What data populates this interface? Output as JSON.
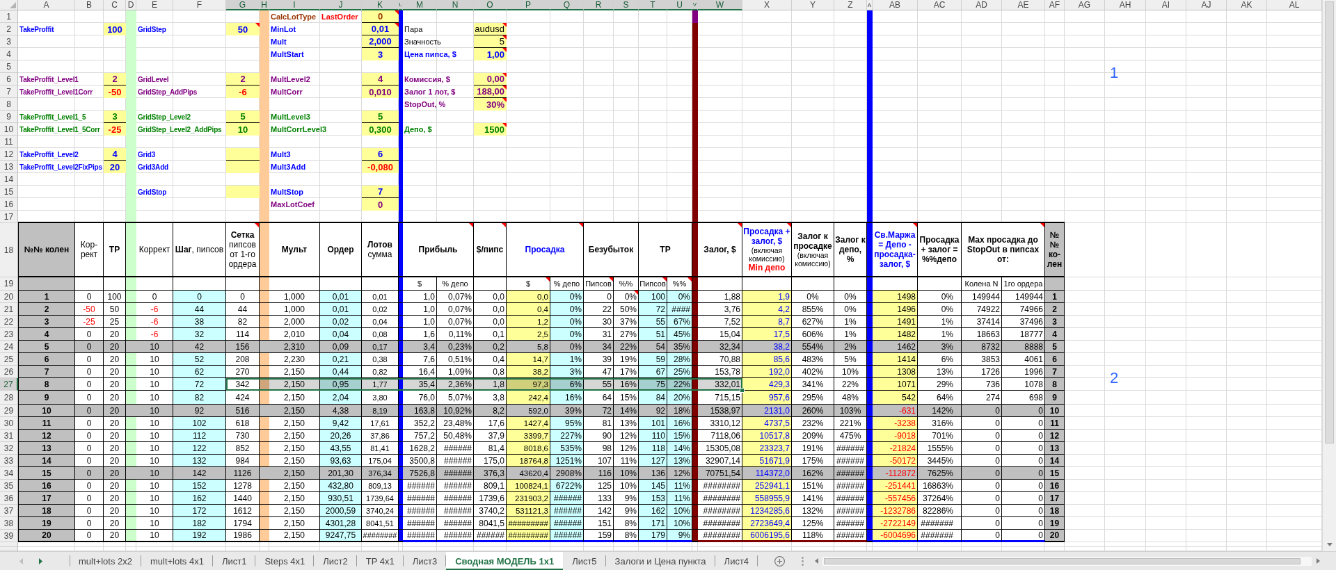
{
  "column_headers": [
    {
      "label": "A",
      "selected": false
    },
    {
      "label": "B",
      "selected": false
    },
    {
      "label": "C",
      "selected": false
    },
    {
      "label": "D",
      "selected": false
    },
    {
      "label": "E",
      "selected": false
    },
    {
      "label": "F",
      "selected": false
    },
    {
      "label": "G",
      "selected": true
    },
    {
      "label": "H",
      "selected": true
    },
    {
      "label": "I",
      "selected": true
    },
    {
      "label": "J",
      "selected": true
    },
    {
      "label": "K",
      "selected": true
    },
    {
      "label": "L",
      "selected": true
    },
    {
      "label": "M",
      "selected": true
    },
    {
      "label": "N",
      "selected": true
    },
    {
      "label": "O",
      "selected": true
    },
    {
      "label": "P",
      "selected": true
    },
    {
      "label": "Q",
      "selected": true
    },
    {
      "label": "R",
      "selected": true
    },
    {
      "label": "S",
      "selected": true
    },
    {
      "label": "T",
      "selected": true
    },
    {
      "label": "U",
      "selected": true
    },
    {
      "label": "V",
      "selected": true
    },
    {
      "label": "W",
      "selected": true
    },
    {
      "label": "X",
      "selected": false
    },
    {
      "label": "Y",
      "selected": false
    },
    {
      "label": "Z",
      "selected": false
    },
    {
      "label": "A",
      "selected": false
    },
    {
      "label": "AB",
      "selected": false
    },
    {
      "label": "AC",
      "selected": false
    },
    {
      "label": "AD",
      "selected": false
    },
    {
      "label": "AE",
      "selected": false
    },
    {
      "label": "AF",
      "selected": false
    },
    {
      "label": "AG",
      "selected": false
    },
    {
      "label": "AH",
      "selected": false
    },
    {
      "label": "AI",
      "selected": false
    },
    {
      "label": "AJ",
      "selected": false
    },
    {
      "label": "AK",
      "selected": false
    },
    {
      "label": "AL",
      "selected": false
    }
  ],
  "rows": [
    {
      "label": "1",
      "selected": false,
      "lot": {
        "label": "CalcLotType",
        "option": {
          "label": "LastOrder",
          "color": "#ff0000"
        },
        "value": "0",
        "color": "#993300",
        "negative": false,
        "bold": true,
        "comment": true
      }
    },
    {
      "label": "2",
      "selected": false,
      "take_profit": {
        "label": "TakeProffit",
        "value": "100",
        "color": "#0000ff",
        "negative": false,
        "bold": true,
        "comment": false
      },
      "grid": {
        "label": "GridStep",
        "value": "50",
        "color": "#0000ff",
        "negative": false,
        "bold": true,
        "comment": true
      },
      "lot": {
        "label": "MinLot",
        "value": "0,01",
        "color": "#0000ff",
        "negative": false,
        "bold": true,
        "comment": true
      },
      "account": {
        "label": "Пара",
        "value": "audusd",
        "color": "#000000",
        "negative": false,
        "bold": false,
        "comment": true
      }
    },
    {
      "label": "3",
      "selected": false,
      "lot": {
        "label": "Mult",
        "value": "2,000",
        "color": "#0000ff",
        "negative": false,
        "bold": true,
        "comment": false
      },
      "account": {
        "label": "Значность",
        "value": "5",
        "color": "#000000",
        "negative": false,
        "bold": false,
        "comment": true
      }
    },
    {
      "label": "4",
      "selected": false,
      "lot": {
        "label": "MultStart",
        "value": "3",
        "color": "#0000ff",
        "negative": false,
        "bold": true,
        "comment": false
      },
      "account": {
        "label": "Цена пипса, $",
        "value": "1,00",
        "color": "#0000ff",
        "negative": false,
        "bold": true,
        "comment": true
      }
    },
    {
      "label": "5",
      "selected": false,
      "note": "1"
    },
    {
      "label": "6",
      "selected": false,
      "take_profit": {
        "label": "TakeProffit_Level1",
        "value": "2",
        "color": "#800080",
        "negative": false,
        "bold": true,
        "comment": false
      },
      "grid": {
        "label": "GridLevel",
        "value": "2",
        "color": "#800080",
        "negative": false,
        "bold": true,
        "comment": false
      },
      "lot": {
        "label": "MultLevel2",
        "value": "4",
        "color": "#800080",
        "negative": false,
        "bold": true,
        "comment": false
      },
      "account": {
        "label": "Комиссия, $",
        "value": "0,00",
        "color": "#800080",
        "negative": false,
        "bold": true,
        "comment": true
      }
    },
    {
      "label": "7",
      "selected": false,
      "take_profit": {
        "label": "TakeProffit_Level1Corr",
        "value": "-50",
        "color": "#800080",
        "negative": true,
        "bold": true,
        "comment": false
      },
      "grid": {
        "label": "GridStep_AddPips",
        "value": "-6",
        "color": "#800080",
        "negative": true,
        "bold": true,
        "comment": false
      },
      "lot": {
        "label": "MultCorr",
        "value": "0,010",
        "color": "#800080",
        "negative": false,
        "bold": true,
        "comment": false
      },
      "account": {
        "label": "Залог 1 лот, $",
        "value": "188,00",
        "color": "#800080",
        "negative": false,
        "bold": true,
        "comment": true
      }
    },
    {
      "label": "8",
      "selected": false,
      "account": {
        "label": "StopOut, %",
        "value": "30%",
        "color": "#800080",
        "negative": false,
        "bold": true,
        "comment": true
      }
    },
    {
      "label": "9",
      "selected": false,
      "take_profit": {
        "label": "TakeProffit_Level1_5",
        "value": "3",
        "color": "#008000",
        "negative": false,
        "bold": true,
        "comment": false
      },
      "grid": {
        "label": "GridStep_Level2",
        "value": "5",
        "color": "#008000",
        "negative": false,
        "bold": true,
        "comment": false
      },
      "lot": {
        "label": "MultLevel3",
        "value": "5",
        "color": "#008000",
        "negative": false,
        "bold": true,
        "comment": false
      }
    },
    {
      "label": "10",
      "selected": false,
      "take_profit": {
        "label": "TakeProffit_Level1_5Corr",
        "value": "-25",
        "color": "#008000",
        "negative": true,
        "bold": true,
        "comment": false
      },
      "grid": {
        "label": "GridStep_Level2_AddPips",
        "value": "10",
        "color": "#008000",
        "negative": false,
        "bold": true,
        "comment": false
      },
      "lot": {
        "label": "MultCorrLevel3",
        "value": "0,300",
        "color": "#008000",
        "negative": false,
        "bold": true,
        "comment": false
      },
      "account": {
        "label": "Депо, $",
        "value": "1500",
        "color": "#008000",
        "negative": false,
        "bold": true,
        "comment": true
      }
    },
    {
      "label": "11",
      "selected": false
    },
    {
      "label": "12",
      "selected": false,
      "take_profit": {
        "label": "TakeProffit_Level2",
        "value": "4",
        "color": "#0000ff",
        "negative": false,
        "bold": true,
        "comment": false
      },
      "grid": {
        "label": "Grid3",
        "color": "#0000ff",
        "bold": true,
        "comment": false
      },
      "lot": {
        "label": "Mult3",
        "value": "6",
        "color": "#0000ff",
        "negative": false,
        "bold": true,
        "comment": false
      }
    },
    {
      "label": "13",
      "selected": false,
      "take_profit": {
        "label": "TakeProffit_Level2FixPips",
        "value": "20",
        "color": "#0000ff",
        "negative": false,
        "bold": true,
        "comment": false
      },
      "grid": {
        "label": "Grid3Add",
        "color": "#0000ff",
        "bold": true,
        "comment": false
      },
      "lot": {
        "label": "Mult3Add",
        "value": "-0,080",
        "color": "#0000ff",
        "negative": true,
        "bold": true,
        "comment": false
      }
    },
    {
      "label": "14",
      "selected": false
    },
    {
      "label": "15",
      "selected": false,
      "grid": {
        "label": "GridStop",
        "color": "#0000ff",
        "bold": true,
        "comment": false
      },
      "lot": {
        "label": "MultStop",
        "value": "7",
        "color": "#0000ff",
        "negative": false,
        "bold": true,
        "comment": false
      }
    },
    {
      "label": "16",
      "selected": false,
      "lot": {
        "label": "MaxLotCoef",
        "value": "0",
        "color": "#800080",
        "negative": false,
        "bold": true,
        "comment": false
      }
    },
    {
      "label": "17",
      "selected": false
    },
    {
      "label": "18",
      "selected": false
    },
    {
      "label": "19",
      "selected": false
    },
    {
      "label": "20",
      "selected": false
    },
    {
      "label": "21",
      "selected": false
    },
    {
      "label": "22",
      "selected": false
    },
    {
      "label": "23",
      "selected": false
    },
    {
      "label": "24",
      "selected": false
    },
    {
      "label": "25",
      "selected": false
    },
    {
      "label": "26",
      "selected": false,
      "note": "2"
    },
    {
      "label": "27",
      "selected": true
    },
    {
      "label": "28",
      "selected": false
    },
    {
      "label": "29",
      "selected": false
    },
    {
      "label": "30",
      "selected": false
    },
    {
      "label": "31",
      "selected": false
    },
    {
      "label": "32",
      "selected": false
    },
    {
      "label": "33",
      "selected": false
    },
    {
      "label": "34",
      "selected": false
    },
    {
      "label": "35",
      "selected": false
    },
    {
      "label": "36",
      "selected": false
    },
    {
      "label": "37",
      "selected": false
    },
    {
      "label": "38",
      "selected": false
    },
    {
      "label": "39",
      "selected": false
    }
  ],
  "table": {
    "columns": [
      {
        "title": "№№ колен",
        "bold": true,
        "comment": false
      },
      {
        "title": "Кор-рект",
        "bold": false,
        "comment": false
      },
      {
        "title": "TP",
        "bold": true,
        "comment": false
      },
      {
        "title": "Коррект",
        "bold": false,
        "comment": false
      },
      {
        "title": "**Шаг**, пипсов",
        "bold": false,
        "comment": false
      },
      {
        "title": "**Сетка** пипсов от 1-го ордера",
        "bold": false,
        "comment": true
      },
      {
        "title": "Мульт",
        "bold": true,
        "comment": false
      },
      {
        "title": "Ордер",
        "bold": true,
        "comment": false
      },
      {
        "title": "**Лотов** сумма",
        "bold": false,
        "comment": false
      },
      {
        "title": "Прибыль",
        "bold": true,
        "comment": true,
        "subheader": {
          "label": "$",
          "comment": false
        }
      },
      {
        "subheader": {
          "label": "% депо",
          "comment": false
        }
      },
      {
        "title": "$/пипс",
        "bold": true,
        "comment": true
      },
      {
        "title": "Просадка",
        "bold": true,
        "color": "#0000ff",
        "comment": true,
        "subheader": {
          "label": "$",
          "comment": true
        }
      },
      {
        "subheader": {
          "label": "% депо",
          "comment": false
        }
      },
      {
        "title": "Безубыток",
        "bold": true,
        "comment": false,
        "subheader": {
          "label": "Пипсов",
          "comment": true
        }
      },
      {
        "subheader": {
          "label": "%%",
          "comment": false
        }
      },
      {
        "title": "TP",
        "bold": true,
        "comment": false,
        "subheader": {
          "label": "Пипсов",
          "comment": true
        }
      },
      {
        "subheader": {
          "label": "%%",
          "comment": true
        }
      },
      {
        "title": "Залог, $",
        "bold": true,
        "comment": true
      },
      {
        "title": "Просадка + залог, $",
        "bold": true,
        "color": "#0000ff",
        "comment": true,
        "note": "(включая комиссию)",
        "footer": {
          "label": "Min депо",
          "color": "#ff0000"
        }
      },
      {
        "title": "Залог к просадке",
        "bold": true,
        "comment": false,
        "note": "(включая комиссию)"
      },
      {
        "title": "Залог к депо, %",
        "bold": true,
        "comment": false
      },
      {
        "title": "Св.Маржа = Депо - просадка- залог, $",
        "bold": true,
        "color": "#0000ff",
        "comment": true
      },
      {
        "title": "Просадка + залог = %%депо",
        "bold": true,
        "comment": false
      },
      {
        "title": "Max просадка до StopOut в пипсах от:",
        "bold": true,
        "comment": true,
        "subheader": {
          "label": "Колена N",
          "comment": false
        }
      },
      {
        "subheader": {
          "label": "1го ордера",
          "comment": false
        }
      },
      {
        "title": "№№ ко-лен",
        "bold": true,
        "comment": false
      }
    ],
    "rows": [
      {
        "shaded": false,
        "selected": false,
        "cells": [
          "1",
          {
            "value": "0",
            "negative": false
          },
          "100",
          {
            "value": "0",
            "negative": false
          },
          "0",
          "0",
          "1,000",
          "0,01",
          "0,01",
          "1,0",
          "0,07%",
          "0,0",
          "0,0",
          "0%",
          "0",
          {
            "value": "0%",
            "comment": true
          },
          "100",
          "0%",
          "1,88",
          "1,9",
          "0%",
          "0%",
          {
            "value": "1498",
            "negative": false
          },
          "0%",
          "149944",
          "149944",
          "1"
        ]
      },
      {
        "shaded": false,
        "selected": false,
        "cells": [
          "2",
          {
            "value": "-50",
            "negative": true
          },
          "50",
          {
            "value": "-6",
            "negative": true
          },
          "44",
          "44",
          "1,000",
          "0,01",
          "0,02",
          "1,0",
          "0,07%",
          "0,0",
          "0,4",
          "0%",
          "22",
          {
            "value": "50%",
            "comment": false
          },
          "72",
          "####",
          "3,76",
          "4,2",
          "855%",
          "0%",
          {
            "value": "1496",
            "negative": false
          },
          "0%",
          "74922",
          "74966",
          "2"
        ]
      },
      {
        "shaded": false,
        "selected": false,
        "cells": [
          "3",
          {
            "value": "-25",
            "negative": true
          },
          "25",
          {
            "value": "-6",
            "negative": true
          },
          "38",
          "82",
          "2,000",
          "0,02",
          "0,04",
          "1,0",
          "0,07%",
          "0,0",
          "1,2",
          "0%",
          "30",
          {
            "value": "37%",
            "comment": false
          },
          "55",
          "67%",
          "7,52",
          "8,7",
          "627%",
          "1%",
          {
            "value": "1491",
            "negative": false
          },
          "1%",
          "37414",
          "37496",
          "3"
        ]
      },
      {
        "shaded": false,
        "selected": false,
        "cells": [
          "4",
          {
            "value": "0",
            "negative": false
          },
          "20",
          {
            "value": "-6",
            "negative": true
          },
          "32",
          "114",
          "2,010",
          "0,04",
          "0,08",
          "1,6",
          "0,11%",
          "0,1",
          "2,5",
          "0%",
          "31",
          {
            "value": "27%",
            "comment": false
          },
          "51",
          "45%",
          "15,04",
          "17,5",
          "606%",
          "1%",
          {
            "value": "1482",
            "negative": false
          },
          "1%",
          "18663",
          "18777",
          "4"
        ]
      },
      {
        "shaded": true,
        "selected": false,
        "cells": [
          "5",
          {
            "value": "0",
            "negative": false
          },
          "20",
          {
            "value": "10",
            "negative": false
          },
          "42",
          "156",
          "2,310",
          "0,09",
          "0,17",
          "3,4",
          "0,23%",
          "0,2",
          "5,8",
          "0%",
          "34",
          {
            "value": "22%",
            "comment": false
          },
          "54",
          "35%",
          "32,34",
          "38,2",
          "554%",
          "2%",
          {
            "value": "1462",
            "negative": false
          },
          "3%",
          "8732",
          "8888",
          "5"
        ]
      },
      {
        "shaded": false,
        "selected": false,
        "cells": [
          "6",
          {
            "value": "0",
            "negative": false
          },
          "20",
          {
            "value": "10",
            "negative": false
          },
          "52",
          "208",
          "2,230",
          "0,21",
          "0,38",
          "7,6",
          "0,51%",
          "0,4",
          "14,7",
          "1%",
          "39",
          {
            "value": "19%",
            "comment": false
          },
          "59",
          "28%",
          "70,88",
          "85,6",
          "483%",
          "5%",
          {
            "value": "1414",
            "negative": false
          },
          "6%",
          "3853",
          "4061",
          "6"
        ]
      },
      {
        "shaded": false,
        "selected": false,
        "cells": [
          "7",
          {
            "value": "0",
            "negative": false
          },
          "20",
          {
            "value": "10",
            "negative": false
          },
          "62",
          "270",
          "2,150",
          "0,44",
          "0,82",
          "16,4",
          "1,09%",
          "0,8",
          "38,2",
          "3%",
          "47",
          {
            "value": "17%",
            "comment": false
          },
          "67",
          "25%",
          "153,78",
          "192,0",
          "402%",
          "10%",
          {
            "value": "1308",
            "negative": false
          },
          "13%",
          "1726",
          "1996",
          "7"
        ]
      },
      {
        "shaded": false,
        "selected": true,
        "cells": [
          "8",
          {
            "value": "0",
            "negative": false
          },
          "20",
          {
            "value": "10",
            "negative": false
          },
          "72",
          "342",
          "2,150",
          "0,95",
          "1,77",
          "35,4",
          "2,36%",
          "1,8",
          "97,3",
          "6%",
          "55",
          {
            "value": "16%",
            "comment": false
          },
          "75",
          "22%",
          "332,01",
          "429,3",
          "341%",
          "22%",
          {
            "value": "1071",
            "negative": false
          },
          "29%",
          "736",
          "1078",
          "8"
        ]
      },
      {
        "shaded": false,
        "selected": false,
        "cells": [
          "9",
          {
            "value": "0",
            "negative": false
          },
          "20",
          {
            "value": "10",
            "negative": false
          },
          "82",
          "424",
          "2,150",
          "2,04",
          "3,80",
          "76,0",
          "5,07%",
          "3,8",
          "242,4",
          "16%",
          "64",
          {
            "value": "15%",
            "comment": false
          },
          "84",
          "20%",
          "715,15",
          "957,6",
          "295%",
          "48%",
          {
            "value": "542",
            "negative": false
          },
          "64%",
          "274",
          "698",
          "9"
        ]
      },
      {
        "shaded": true,
        "selected": false,
        "cells": [
          "10",
          {
            "value": "0",
            "negative": false
          },
          "20",
          {
            "value": "10",
            "negative": false
          },
          "92",
          "516",
          "2,150",
          "4,38",
          "8,19",
          "163,8",
          "10,92%",
          "8,2",
          "592,0",
          "39%",
          "72",
          {
            "value": "14%",
            "comment": false
          },
          "92",
          "18%",
          "1538,97",
          "2131,0",
          "260%",
          "103%",
          {
            "value": "-631",
            "negative": true
          },
          "142%",
          "0",
          "0",
          "10"
        ]
      },
      {
        "shaded": false,
        "selected": false,
        "cells": [
          "11",
          {
            "value": "0",
            "negative": false
          },
          "20",
          {
            "value": "10",
            "negative": false
          },
          "102",
          "618",
          "2,150",
          "9,42",
          "17,61",
          "352,2",
          "23,48%",
          "17,6",
          "1427,4",
          "95%",
          "81",
          {
            "value": "13%",
            "comment": false
          },
          "101",
          "16%",
          "3310,12",
          "4737,5",
          "232%",
          "221%",
          {
            "value": "-3238",
            "negative": true
          },
          "316%",
          "0",
          "0",
          "11"
        ]
      },
      {
        "shaded": false,
        "selected": false,
        "cells": [
          "12",
          {
            "value": "0",
            "negative": false
          },
          "20",
          {
            "value": "10",
            "negative": false
          },
          "112",
          "730",
          "2,150",
          "20,26",
          "37,86",
          "757,2",
          "50,48%",
          "37,9",
          "3399,7",
          "227%",
          "90",
          {
            "value": "12%",
            "comment": false
          },
          "110",
          "15%",
          "7118,06",
          "10517,8",
          "209%",
          "475%",
          {
            "value": "-9018",
            "negative": true
          },
          "701%",
          "0",
          "0",
          "12"
        ]
      },
      {
        "shaded": false,
        "selected": false,
        "cells": [
          "13",
          {
            "value": "0",
            "negative": false
          },
          "20",
          {
            "value": "10",
            "negative": false
          },
          "122",
          "852",
          "2,150",
          "43,55",
          "81,41",
          "1628,2",
          "######",
          "81,4",
          "8018,6",
          "535%",
          "98",
          {
            "value": "12%",
            "comment": false
          },
          "118",
          "14%",
          "15305,08",
          "23323,7",
          "191%",
          "######",
          {
            "value": "-21824",
            "negative": true
          },
          "1555%",
          "0",
          "0",
          "13"
        ]
      },
      {
        "shaded": false,
        "selected": false,
        "cells": [
          "14",
          {
            "value": "0",
            "negative": false
          },
          "20",
          {
            "value": "10",
            "negative": false
          },
          "132",
          "984",
          "2,150",
          "93,63",
          "175,04",
          "3500,8",
          "######",
          "175,0",
          "18764,8",
          "1251%",
          "107",
          {
            "value": "11%",
            "comment": false
          },
          "127",
          "13%",
          "32907,14",
          "51671,9",
          "175%",
          "######",
          {
            "value": "-50172",
            "negative": true
          },
          "3445%",
          "0",
          "0",
          "14"
        ]
      },
      {
        "shaded": true,
        "selected": false,
        "cells": [
          "15",
          {
            "value": "0",
            "negative": false
          },
          "20",
          {
            "value": "10",
            "negative": false
          },
          "142",
          "1126",
          "2,150",
          "201,30",
          "376,34",
          "7526,8",
          "######",
          "376,3",
          "43620,4",
          "2908%",
          "116",
          {
            "value": "10%",
            "comment": false
          },
          "136",
          "12%",
          "70751,54",
          "114372,0",
          "162%",
          "######",
          {
            "value": "-112872",
            "negative": true
          },
          "7625%",
          "0",
          "0",
          "15"
        ]
      },
      {
        "shaded": false,
        "selected": false,
        "cells": [
          "16",
          {
            "value": "0",
            "negative": false
          },
          "20",
          {
            "value": "10",
            "negative": false
          },
          "152",
          "1278",
          "2,150",
          "432,80",
          "809,13",
          "######",
          "######",
          "809,1",
          "100824,1",
          "6722%",
          "125",
          {
            "value": "10%",
            "comment": false
          },
          "145",
          "11%",
          "########",
          "252941,1",
          "151%",
          "######",
          {
            "value": "-251441",
            "negative": true
          },
          "16863%",
          "0",
          "0",
          "16"
        ]
      },
      {
        "shaded": false,
        "selected": false,
        "cells": [
          "17",
          {
            "value": "0",
            "negative": false
          },
          "20",
          {
            "value": "10",
            "negative": false
          },
          "162",
          "1440",
          "2,150",
          "930,51",
          "1739,64",
          "######",
          "######",
          "1739,6",
          "231903,2",
          "######",
          "133",
          {
            "value": "9%",
            "comment": false
          },
          "153",
          "11%",
          "########",
          "558955,9",
          "141%",
          "######",
          {
            "value": "-557456",
            "negative": true
          },
          "37264%",
          "0",
          "0",
          "17"
        ]
      },
      {
        "shaded": false,
        "selected": false,
        "cells": [
          "18",
          {
            "value": "0",
            "negative": false
          },
          "20",
          {
            "value": "10",
            "negative": false
          },
          "172",
          "1612",
          "2,150",
          "2000,59",
          "3740,24",
          "######",
          "######",
          "3740,2",
          "531121,3",
          "######",
          "142",
          {
            "value": "9%",
            "comment": false
          },
          "162",
          "10%",
          "########",
          "1234285,6",
          "132%",
          "######",
          {
            "value": "-1232786",
            "negative": true
          },
          "82286%",
          "0",
          "0",
          "18"
        ]
      },
      {
        "shaded": false,
        "selected": false,
        "cells": [
          "19",
          {
            "value": "0",
            "negative": false
          },
          "20",
          {
            "value": "10",
            "negative": false
          },
          "182",
          "1794",
          "2,150",
          "4301,28",
          "8041,51",
          "######",
          "######",
          "8041,5",
          "#########",
          "######",
          "151",
          {
            "value": "8%",
            "comment": false
          },
          "171",
          "10%",
          "########",
          "2723649,4",
          "125%",
          "######",
          {
            "value": "-2722149",
            "negative": true
          },
          "#######",
          "0",
          "0",
          "19"
        ]
      },
      {
        "shaded": false,
        "selected": false,
        "cells": [
          "20",
          {
            "value": "0",
            "negative": false
          },
          "20",
          {
            "value": "10",
            "negative": false
          },
          "192",
          "1986",
          "2,150",
          "9247,75",
          "########",
          "######",
          "######",
          "######",
          "#########",
          "######",
          "159",
          {
            "value": "8%",
            "comment": false
          },
          "179",
          "9%",
          "########",
          "6006195,6",
          "118%",
          "######",
          {
            "value": "-6004696",
            "negative": true
          },
          "#######",
          "0",
          "0",
          "20"
        ]
      }
    ]
  },
  "sheet_tabs": [
    {
      "label": "mult+lots 2x2",
      "selected": false
    },
    {
      "label": "mult+lots 4x1",
      "selected": false
    },
    {
      "label": "Лист1",
      "selected": false
    },
    {
      "label": "Steps 4x1",
      "selected": false
    },
    {
      "label": "Лист2",
      "selected": false
    },
    {
      "label": "TP 4x1",
      "selected": false
    },
    {
      "label": "Лист3",
      "selected": false
    },
    {
      "label": "Сводная МОДЕЛЬ 1x1",
      "selected": true
    },
    {
      "label": "Лист5",
      "selected": false
    },
    {
      "label": "Залоги и Цена пункта",
      "selected": false
    },
    {
      "label": "Лист4",
      "selected": false
    }
  ]
}
